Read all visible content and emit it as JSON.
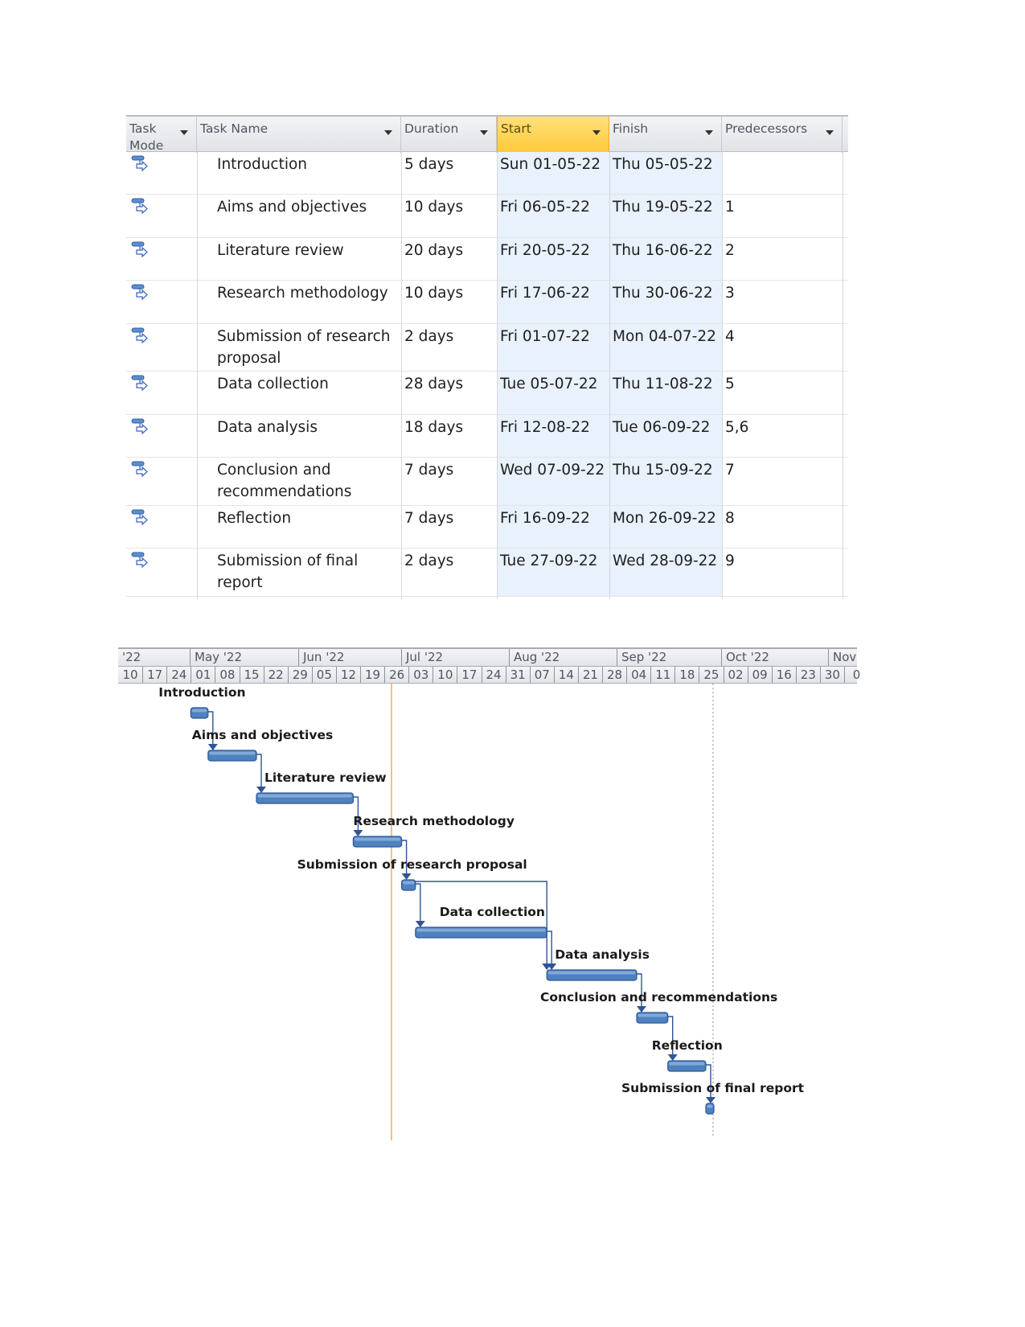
{
  "table": {
    "columns": [
      {
        "key": "mode",
        "label": "Task Mode"
      },
      {
        "key": "name",
        "label": "Task Name"
      },
      {
        "key": "duration",
        "label": "Duration"
      },
      {
        "key": "start",
        "label": "Start"
      },
      {
        "key": "finish",
        "label": "Finish"
      },
      {
        "key": "predecessors",
        "label": "Predecessors"
      }
    ],
    "selected_column": "start",
    "task_mode_icon": "auto-scheduled-task-icon",
    "rows": [
      {
        "name": "Introduction",
        "duration": "5 days",
        "start": "Sun 01-05-22",
        "finish": "Thu 05-05-22",
        "predecessors": ""
      },
      {
        "name": "Aims and objectives",
        "duration": "10 days",
        "start": "Fri 06-05-22",
        "finish": "Thu 19-05-22",
        "predecessors": "1"
      },
      {
        "name": "Literature review",
        "duration": "20 days",
        "start": "Fri 20-05-22",
        "finish": "Thu 16-06-22",
        "predecessors": "2"
      },
      {
        "name": "Research methodology",
        "duration": "10 days",
        "start": "Fri 17-06-22",
        "finish": "Thu 30-06-22",
        "predecessors": "3"
      },
      {
        "name": "Submission of research proposal",
        "duration": "2 days",
        "start": "Fri 01-07-22",
        "finish": "Mon 04-07-22",
        "predecessors": "4"
      },
      {
        "name": "Data collection",
        "duration": "28 days",
        "start": "Tue 05-07-22",
        "finish": "Thu 11-08-22",
        "predecessors": "5"
      },
      {
        "name": "Data analysis",
        "duration": "18 days",
        "start": "Fri 12-08-22",
        "finish": "Tue 06-09-22",
        "predecessors": "5,6"
      },
      {
        "name": "Conclusion and recommendations",
        "duration": "7 days",
        "start": "Wed 07-09-22",
        "finish": "Thu 15-09-22",
        "predecessors": "7"
      },
      {
        "name": "Reflection",
        "duration": "7 days",
        "start": "Fri 16-09-22",
        "finish": "Mon 26-09-22",
        "predecessors": "8"
      },
      {
        "name": "Submission of final report",
        "duration": "2 days",
        "start": "Tue 27-09-22",
        "finish": "Wed 28-09-22",
        "predecessors": "9"
      }
    ]
  },
  "gantt": {
    "months": [
      "'22",
      "May '22",
      "Jun '22",
      "Jul '22",
      "Aug '22",
      "Sep '22",
      "Oct '22",
      "Nov"
    ],
    "weeks": [
      "10",
      "17",
      "24",
      "01",
      "08",
      "15",
      "22",
      "29",
      "05",
      "12",
      "19",
      "26",
      "03",
      "10",
      "17",
      "24",
      "31",
      "07",
      "14",
      "21",
      "28",
      "04",
      "11",
      "18",
      "25",
      "02",
      "09",
      "16",
      "23",
      "30",
      "0"
    ],
    "bar_color": "#4f81bd",
    "link_color": "#2f5597",
    "today_line_color": "#f0a860",
    "labels": [
      "Introduction",
      "Aims and objectives",
      "Literature review",
      "Research methodology",
      "Submission of research proposal",
      "Data collection",
      "Data analysis",
      "Conclusion and recommendations",
      "Reflection",
      "Submission of final report"
    ]
  }
}
